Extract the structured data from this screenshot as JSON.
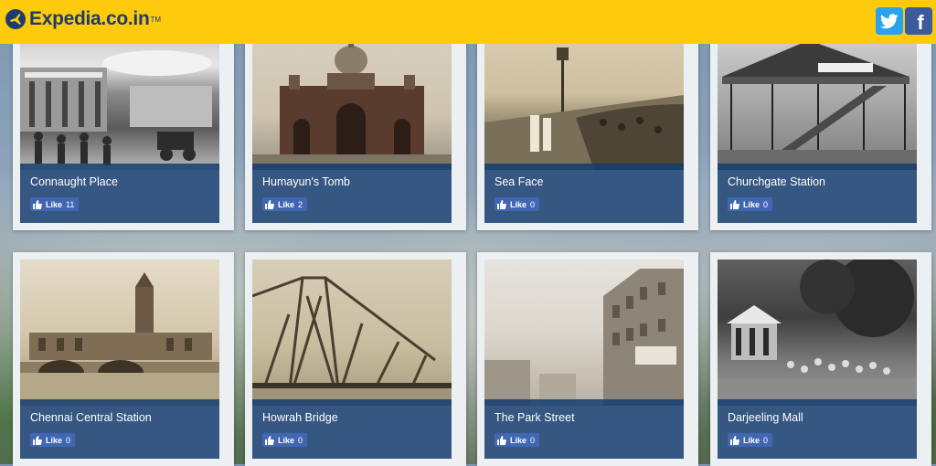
{
  "header": {
    "logo_text": "Expedia.co.in",
    "logo_tm": "TM",
    "brand_color": "#fdcb0b",
    "twitter_icon": "twitter-icon",
    "facebook_icon": "facebook-icon"
  },
  "cards": [
    {
      "title": "Connaught Place",
      "like_label": "Like",
      "like_count": "11"
    },
    {
      "title": "Humayun's Tomb",
      "like_label": "Like",
      "like_count": "2"
    },
    {
      "title": "Sea Face",
      "like_label": "Like",
      "like_count": "0"
    },
    {
      "title": "Churchgate Station",
      "like_label": "Like",
      "like_count": "0"
    },
    {
      "title": "Chennai Central Station",
      "like_label": "Like",
      "like_count": "0"
    },
    {
      "title": "Howrah Bridge",
      "like_label": "Like",
      "like_count": "0"
    },
    {
      "title": "The Park Street",
      "like_label": "Like",
      "like_count": "0"
    },
    {
      "title": "Darjeeling Mall",
      "like_label": "Like",
      "like_count": "0"
    }
  ]
}
